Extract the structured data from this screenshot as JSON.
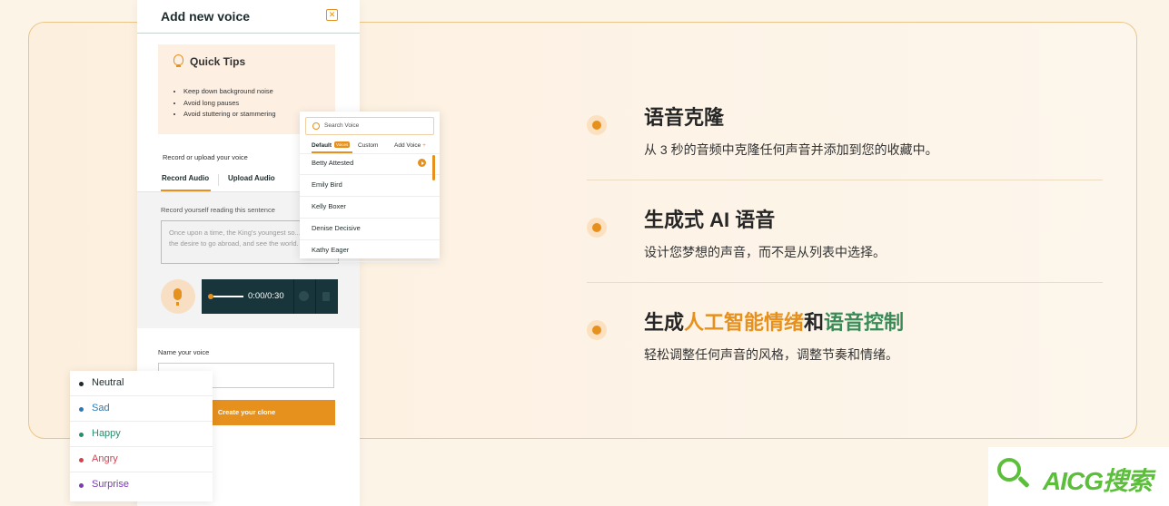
{
  "panel": {
    "title": "Add new voice",
    "close_icon": "close-icon",
    "tips_title": "Quick Tips",
    "tips": [
      "Keep down background noise",
      "Avoid long pauses",
      "Avoid stuttering or stammering"
    ],
    "record_label": "Record or upload your voice",
    "tab_record": "Record Audio",
    "tab_upload": "Upload Audio",
    "sentence_label": "Record yourself reading this sentence",
    "sentence_text": "Once upon a time, the King's youngest so... filled with the desire to go abroad, and see the world.",
    "player_time": "0:00/0:30",
    "name_label": "Name your voice",
    "name_value": "",
    "create_button": "Create your clone"
  },
  "voice_popup": {
    "search_placeholder": "Search Voice",
    "tab_default": "Default",
    "badge": "Voices",
    "tab_custom": "Custom",
    "tab_add": "Add Voice",
    "add_symbol": "+",
    "voices": [
      "Betty Attested",
      "Emily Bird",
      "Kelly Boxer",
      "Denise Decisive",
      "Kathy Eager"
    ]
  },
  "emotions": [
    {
      "label": "Neutral",
      "color": "#1d2b2c"
    },
    {
      "label": "Sad",
      "color": "#2a7bb5"
    },
    {
      "label": "Happy",
      "color": "#2a8c6e"
    },
    {
      "label": "Angry",
      "color": "#d6414d"
    },
    {
      "label": "Surprise",
      "color": "#7a3bb5"
    }
  ],
  "features": [
    {
      "title": "语音克隆",
      "desc": "从 3 秒的音频中克隆任何声音并添加到您的收藏中。"
    },
    {
      "title": "生成式 AI 语音",
      "desc": "设计您梦想的声音，而不是从列表中选择。"
    },
    {
      "title_prefix": "生成",
      "title_orange": "人工智能情绪",
      "title_mid": "和",
      "title_green": "语音控制",
      "desc": "轻松调整任何声音的风格，调整节奏和情绪。"
    }
  ],
  "watermark": {
    "text": "AICG搜索"
  },
  "colors": {
    "accent": "#e6901e",
    "dark": "#17353a",
    "green": "#5cbf3b"
  }
}
